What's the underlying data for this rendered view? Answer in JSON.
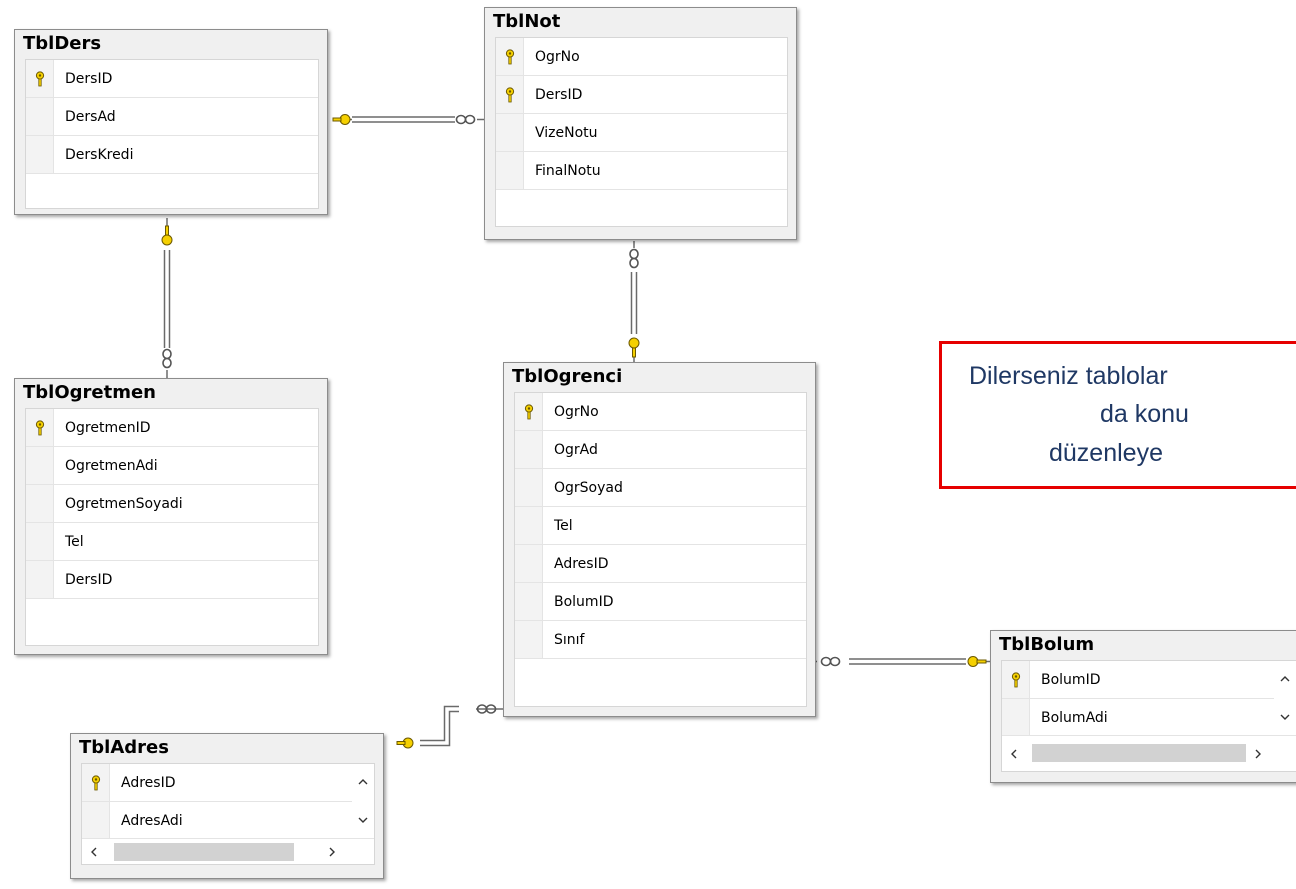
{
  "tables": {
    "ders": {
      "title": "TblDers",
      "columns": [
        "DersID",
        "DersAd",
        "DersKredi"
      ]
    },
    "not": {
      "title": "TblNot",
      "columns": [
        "OgrNo",
        "DersID",
        "VizeNotu",
        "FinalNotu"
      ]
    },
    "ogretmen": {
      "title": "TblOgretmen",
      "columns": [
        "OgretmenID",
        "OgretmenAdi",
        "OgretmenSoyadi",
        "Tel",
        "DersID"
      ]
    },
    "ogrenci": {
      "title": "TblOgrenci",
      "columns": [
        "OgrNo",
        "OgrAd",
        "OgrSoyad",
        "Tel",
        "AdresID",
        "BolumID",
        "Sınıf"
      ]
    },
    "adres": {
      "title": "TblAdres",
      "columns": [
        "AdresID",
        "AdresAdi"
      ]
    },
    "bolum": {
      "title": "TblBolum",
      "columns": [
        "BolumID",
        "BolumAdi"
      ]
    }
  },
  "note": {
    "line1": "Dilerseniz tablolar",
    "line2": "da konu",
    "line3": "düzenleye"
  },
  "colors": {
    "note_border": "#e60000",
    "note_text": "#1f3864",
    "key": "#f5d000",
    "relationship_line": "#6a6a6a"
  },
  "icons": {
    "primary_key": "key-icon",
    "scroll_up": "chevron-up-icon",
    "scroll_down": "chevron-down-icon",
    "scroll_left": "chevron-left-icon",
    "scroll_right": "chevron-right-icon",
    "one_end": "key-endpoint-icon",
    "many_end": "infinity-icon"
  }
}
